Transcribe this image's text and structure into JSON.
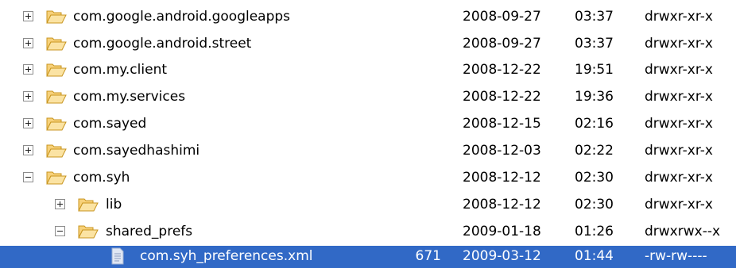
{
  "colors": {
    "selection": "#3169c6",
    "folder": "#f0c466"
  },
  "icons": {
    "expand": "plus-box-icon",
    "collapse": "minus-box-icon",
    "folder": "open-folder-icon",
    "file": "document-icon"
  },
  "rows": [
    {
      "name": "com.google.android.googleapps",
      "size": "",
      "date": "2008-09-27",
      "time": "03:37",
      "perm": "drwxr-xr-x",
      "state": "collapsed"
    },
    {
      "name": "com.google.android.street",
      "size": "",
      "date": "2008-09-27",
      "time": "03:37",
      "perm": "drwxr-xr-x",
      "state": "collapsed"
    },
    {
      "name": "com.my.client",
      "size": "",
      "date": "2008-12-22",
      "time": "19:51",
      "perm": "drwxr-xr-x",
      "state": "collapsed"
    },
    {
      "name": "com.my.services",
      "size": "",
      "date": "2008-12-22",
      "time": "19:36",
      "perm": "drwxr-xr-x",
      "state": "collapsed"
    },
    {
      "name": "com.sayed",
      "size": "",
      "date": "2008-12-15",
      "time": "02:16",
      "perm": "drwxr-xr-x",
      "state": "collapsed"
    },
    {
      "name": "com.sayedhashimi",
      "size": "",
      "date": "2008-12-03",
      "time": "02:22",
      "perm": "drwxr-xr-x",
      "state": "collapsed"
    },
    {
      "name": "com.syh",
      "size": "",
      "date": "2008-12-12",
      "time": "02:30",
      "perm": "drwxr-xr-x",
      "state": "expanded"
    },
    {
      "name": "lib",
      "size": "",
      "date": "2008-12-12",
      "time": "02:30",
      "perm": "drwxr-xr-x",
      "state": "collapsed"
    },
    {
      "name": "shared_prefs",
      "size": "",
      "date": "2009-01-18",
      "time": "01:26",
      "perm": "drwxrwx--x",
      "state": "expanded"
    },
    {
      "name": "com.syh_preferences.xml",
      "size": "671",
      "date": "2009-03-12",
      "time": "01:44",
      "perm": "-rw-rw----",
      "state": "file",
      "selected": true
    }
  ]
}
